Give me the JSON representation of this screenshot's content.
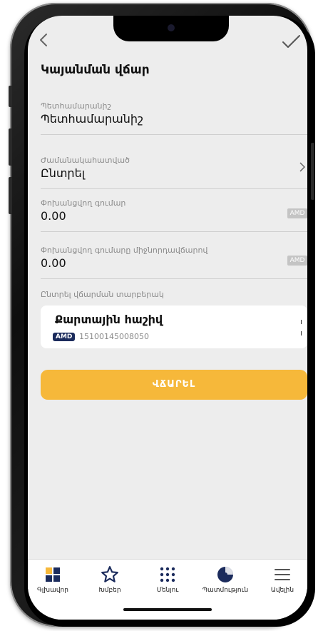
{
  "header": {
    "title": "Կայանման վճար"
  },
  "fields": [
    {
      "label": "Պետհամարանիշ",
      "value": "Պետհամարանիշ"
    },
    {
      "label": "Ժամանակահատված",
      "value": "Ընտրել"
    },
    {
      "label": "Փոխանցվող գումար",
      "value": "0.00",
      "currency": "AMD"
    },
    {
      "label": "Փոխանցվող գումարը միջնորդավճարով",
      "value": "0.00",
      "currency": "AMD"
    }
  ],
  "payment": {
    "section_label": "Ընտրել վճարման տարբերակ",
    "account_name": "Քարտային հաշիվ",
    "currency": "AMD",
    "account_number": "15100145008050"
  },
  "pay_button": "ՎՃԱՐԵԼ",
  "tabs": [
    {
      "label": "Գլխավոր",
      "icon": "dashboard-icon"
    },
    {
      "label": "Խմբեր",
      "icon": "star-icon"
    },
    {
      "label": "Մենյու",
      "icon": "grid-dots-icon"
    },
    {
      "label": "Պատմություն",
      "icon": "history-clock-icon"
    },
    {
      "label": "Ավելին",
      "icon": "hamburger-menu-icon"
    }
  ],
  "colors": {
    "accent": "#f6b83a",
    "screen_bg": "#ededed",
    "badge_navy": "#1b2b5c"
  }
}
